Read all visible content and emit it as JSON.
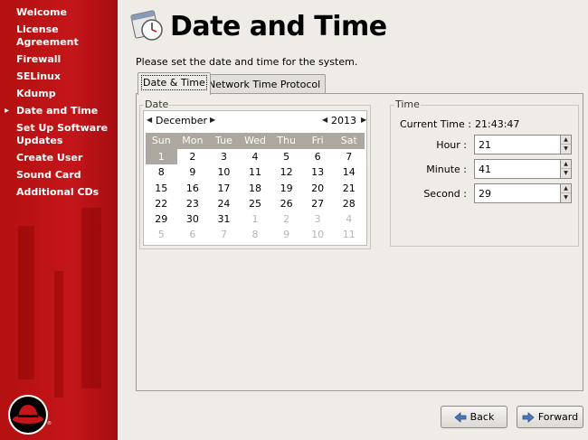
{
  "sidebar": {
    "items": [
      {
        "label": "Welcome"
      },
      {
        "label": "License Agreement"
      },
      {
        "label": "Firewall"
      },
      {
        "label": "SELinux"
      },
      {
        "label": "Kdump"
      },
      {
        "label": "Date and Time",
        "active": true
      },
      {
        "label": "Set Up Software Updates"
      },
      {
        "label": "Create User"
      },
      {
        "label": "Sound Card"
      },
      {
        "label": "Additional CDs"
      }
    ],
    "logo_mark": "®"
  },
  "header": {
    "title": "Date and Time",
    "prompt": "Please set the date and time for the system."
  },
  "tabs": [
    {
      "label": "Date & Time",
      "active": true
    },
    {
      "label": "Network Time Protocol",
      "active": false
    }
  ],
  "date_frame": {
    "label": "Date",
    "month": "December",
    "year": "2013",
    "weekdays": [
      "Sun",
      "Mon",
      "Tue",
      "Wed",
      "Thu",
      "Fri",
      "Sat"
    ],
    "weeks": [
      [
        "1",
        "2",
        "3",
        "4",
        "5",
        "6",
        "7"
      ],
      [
        "8",
        "9",
        "10",
        "11",
        "12",
        "13",
        "14"
      ],
      [
        "15",
        "16",
        "17",
        "18",
        "19",
        "20",
        "21"
      ],
      [
        "22",
        "23",
        "24",
        "25",
        "26",
        "27",
        "28"
      ],
      [
        "29",
        "30",
        "31",
        "1",
        "2",
        "3",
        "4"
      ],
      [
        "5",
        "6",
        "7",
        "8",
        "9",
        "10",
        "11"
      ]
    ],
    "selected_day": "1"
  },
  "time_frame": {
    "label": "Time",
    "current_time_label": "Current Time :",
    "current_time_value": "21:43:47",
    "hour_label": "Hour :",
    "hour_value": "21",
    "minute_label": "Minute :",
    "minute_value": "41",
    "second_label": "Second :",
    "second_value": "29"
  },
  "buttons": {
    "back": "Back",
    "forward": "Forward"
  },
  "colors": {
    "sidebar_red": "#c4161a",
    "calendar_header": "#aca79f",
    "background": "#efebe7"
  }
}
